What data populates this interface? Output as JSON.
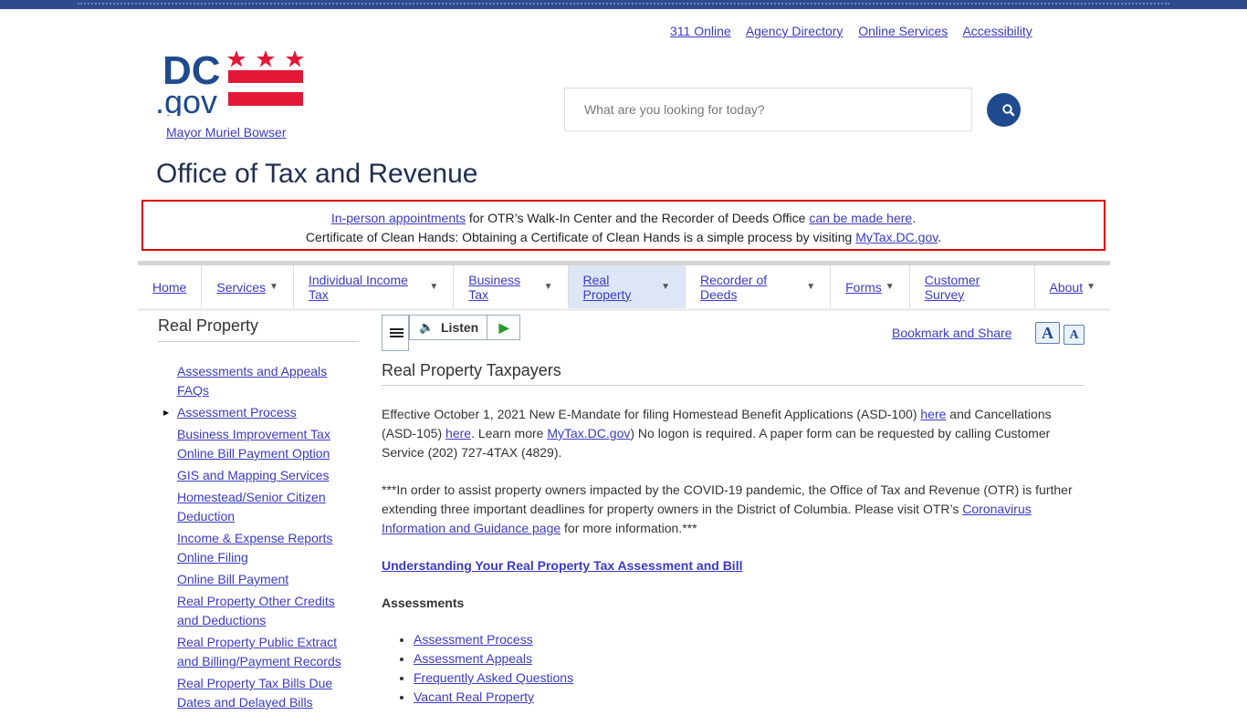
{
  "utility_links": [
    "311 Online",
    "Agency Directory",
    "Online Services",
    "Accessibility"
  ],
  "logo": {
    "text_dc": "DC",
    "text_gov": ".gov"
  },
  "mayor_link": "Mayor Muriel Bowser",
  "search": {
    "placeholder": "What are you looking for today?"
  },
  "site_title": "Office of Tax and Revenue",
  "alert": {
    "line1_link1": "In-person appointments",
    "line1_text": " for OTR’s Walk-In Center and the Recorder of Deeds Office ",
    "line1_link2": "can be made here",
    "line1_end": ".",
    "line2_text": "Certificate of Clean Hands: Obtaining a Certificate of Clean Hands is a simple process by visiting ",
    "line2_link": "MyTax.DC.gov",
    "line2_end": "."
  },
  "nav": [
    {
      "label": "Home",
      "dropdown": false,
      "active": false
    },
    {
      "label": "Services",
      "dropdown": true,
      "active": false
    },
    {
      "label": "Individual Income Tax",
      "dropdown": true,
      "active": false
    },
    {
      "label": "Business Tax",
      "dropdown": true,
      "active": false
    },
    {
      "label": "Real Property",
      "dropdown": true,
      "active": true
    },
    {
      "label": "Recorder of Deeds",
      "dropdown": true,
      "active": false
    },
    {
      "label": "Forms",
      "dropdown": true,
      "active": false
    },
    {
      "label": "Customer Survey",
      "dropdown": false,
      "active": false
    },
    {
      "label": "About",
      "dropdown": true,
      "active": false
    }
  ],
  "sidebar": {
    "title": "Real Property",
    "items": [
      "Assessments and Appeals FAQs",
      "Assessment Process",
      "Business Improvement Tax Online Bill Payment Option",
      "GIS and Mapping Services",
      "Homestead/Senior Citizen Deduction",
      "Income & Expense Reports Online Filing",
      "Online Bill Payment",
      "Real Property Other Credits and Deductions",
      "Real Property Public Extract and Billing/Payment Records",
      "Real Property Tax Bills Due Dates and Delayed Bills"
    ],
    "current_index": 1
  },
  "toolbar": {
    "listen_label": "Listen"
  },
  "share": {
    "label": "Bookmark and Share"
  },
  "font_buttons": {
    "increase": "A",
    "decrease": "A"
  },
  "content": {
    "title": "Real Property Taxpayers",
    "p1": {
      "t1": "Effective October 1, 2021 New E-Mandate for filing Homestead Benefit Applications (ASD-100) ",
      "l1": "here",
      "t2": " and Cancellations (ASD-105) ",
      "l2": "here",
      "t3": ". Learn more ",
      "l3": "MyTax.DC.gov",
      "t4": ") No logon is required. A paper form can be requested by calling Customer Service (202) 727-4TAX (4829)."
    },
    "p2": {
      "t1": "***In order to assist property owners impacted by the COVID-19 pandemic, the Office of Tax and Revenue (OTR) is further extending three important deadlines for property owners in the District of Columbia. Please visit OTR’s ",
      "l1": "Coronavirus Information and Guidance page",
      "t2": " for more information.***"
    },
    "understanding_link": "Understanding Your Real Property Tax Assessment and Bill",
    "assessments_heading": "Assessments",
    "assessment_links": [
      "Assessment Process",
      "Assessment Appeals",
      "Frequently Asked Questions",
      "Vacant Real Property"
    ]
  },
  "colors": {
    "brand_blue": "#1f4b8e",
    "flag_red": "#e31837",
    "alert_border": "#d90000",
    "link": "#3a3ac7"
  }
}
